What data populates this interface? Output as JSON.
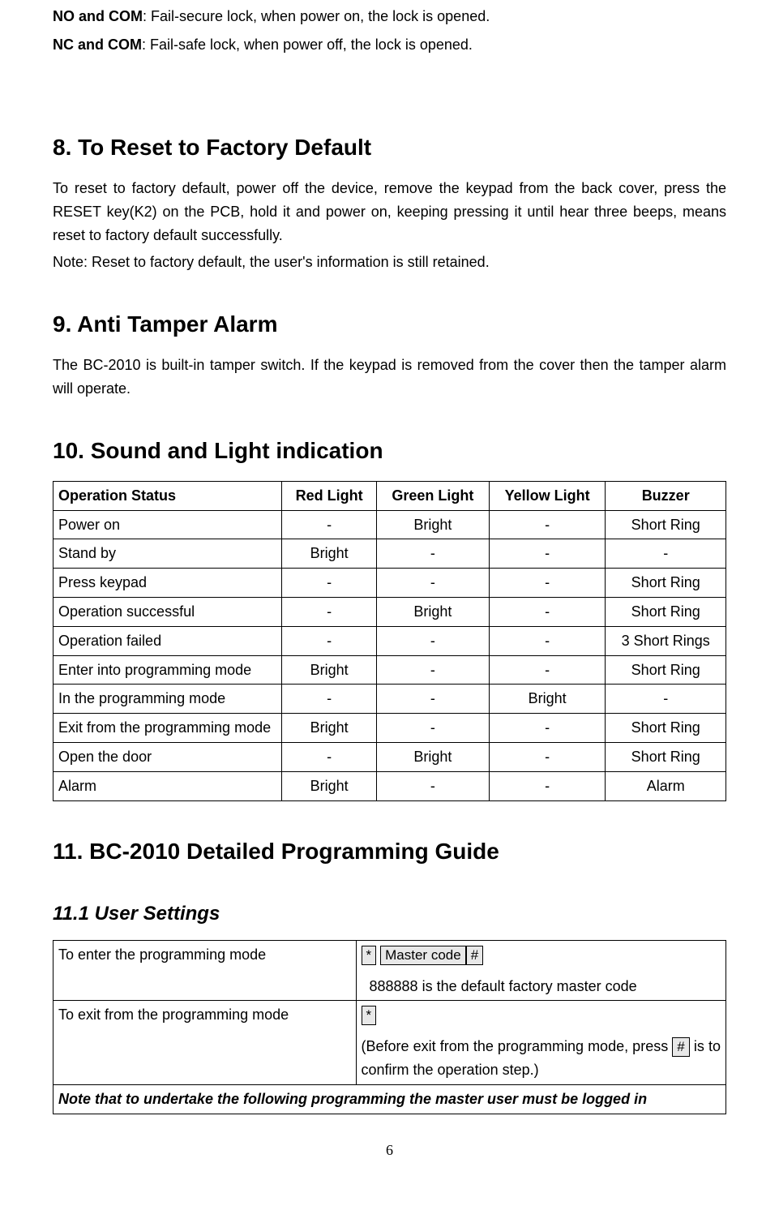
{
  "top": {
    "no_com_label": "NO and COM",
    "no_com_text": ": Fail-secure lock, when power on, the lock is opened.",
    "nc_com_label": "NC and COM",
    "nc_com_text": ": Fail-safe lock, when power off, the lock is opened."
  },
  "s8": {
    "heading": "8.      To Reset to Factory Default",
    "body": "To reset to factory default, power off the device, remove the keypad from the back cover, press the RESET key(K2) on the PCB, hold it and power on, keeping pressing it until hear three beeps, means reset to factory default successfully.",
    "note": "Note: Reset to factory default, the user's information is still retained."
  },
  "s9": {
    "heading": "9.  Anti Tamper Alarm",
    "body": "The BC-2010 is built-in tamper switch. If the keypad is removed from the cover then the tamper alarm will operate."
  },
  "s10": {
    "heading": "10.    Sound and Light indication",
    "headers": [
      "Operation Status",
      "Red Light",
      "Green Light",
      "Yellow Light",
      "Buzzer"
    ],
    "rows": [
      [
        "Power on",
        "-",
        "Bright",
        "-",
        "Short Ring"
      ],
      [
        "Stand by",
        "Bright",
        "-",
        "-",
        "-"
      ],
      [
        "Press keypad",
        "-",
        "-",
        "-",
        "Short Ring"
      ],
      [
        "Operation successful",
        "-",
        "Bright",
        "-",
        "Short Ring"
      ],
      [
        "Operation failed",
        "-",
        "-",
        "-",
        "3 Short Rings"
      ],
      [
        "Enter into programming mode",
        "Bright",
        "-",
        "-",
        "Short Ring"
      ],
      [
        "In the programming mode",
        "-",
        "-",
        "Bright",
        "-"
      ],
      [
        "Exit from the programming mode",
        "Bright",
        "-",
        "-",
        "Short Ring"
      ],
      [
        "Open the door",
        "-",
        "Bright",
        "-",
        "Short Ring"
      ],
      [
        "Alarm",
        "Bright",
        "-",
        "-",
        "Alarm"
      ]
    ]
  },
  "s11": {
    "heading": "11.    BC-2010 Detailed Programming Guide",
    "sub_heading": "11.1    User Settings",
    "row1_label": "To enter the programming mode",
    "row1_k1": " * ",
    "row1_k2": "Master code",
    "row1_k3": "#",
    "row1_sub": "888888 is the default factory master code",
    "row2_label": "To exit from the programming mode",
    "row2_k1": " * ",
    "row2_pre": "(Before exit from the programming mode, press",
    "row2_k2": " # ",
    "row2_post": "is to confirm the operation step.)",
    "note": "Note that to undertake the following programming the master user must be logged in"
  },
  "page": "6"
}
